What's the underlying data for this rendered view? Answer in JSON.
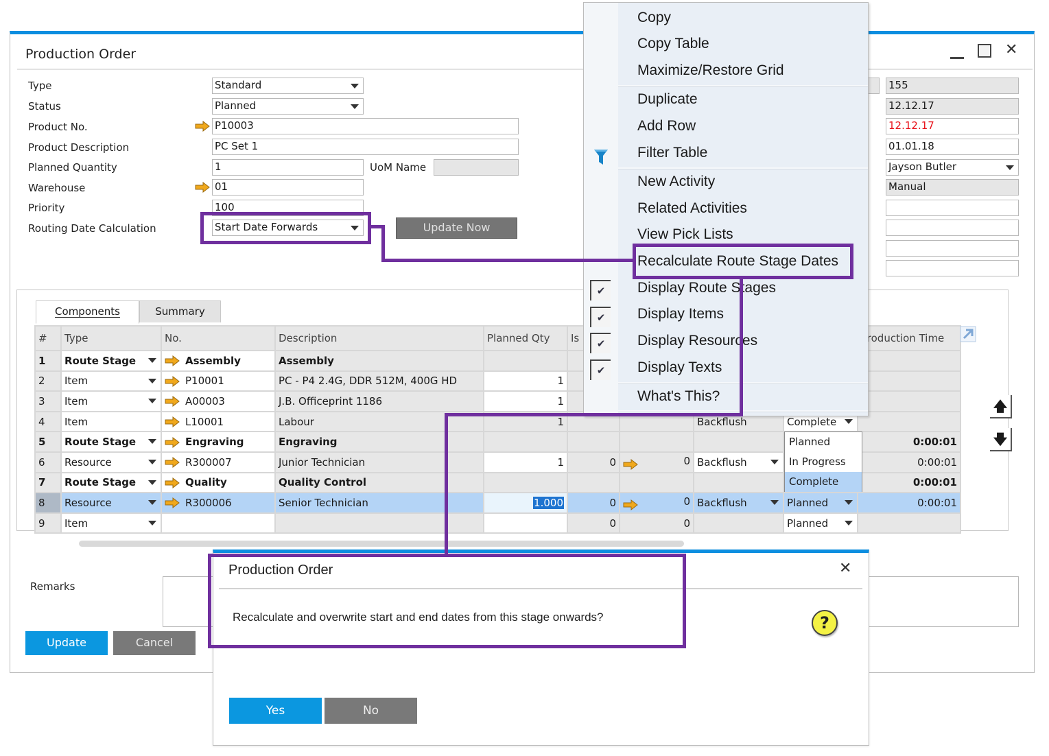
{
  "window": {
    "title": "Production Order",
    "controls": [
      "minimize-icon",
      "maximize-icon",
      "close-icon"
    ]
  },
  "header_left": {
    "type": {
      "label": "Type",
      "value": "Standard"
    },
    "status": {
      "label": "Status",
      "value": "Planned"
    },
    "product_no": {
      "label": "Product No.",
      "value": "P10003"
    },
    "product_description": {
      "label": "Product Description",
      "value": "PC Set 1"
    },
    "planned_quantity": {
      "label": "Planned Quantity",
      "value": "1"
    },
    "uom_name": {
      "label": "UoM Name",
      "value": ""
    },
    "warehouse": {
      "label": "Warehouse",
      "value": "01"
    },
    "priority": {
      "label": "Priority",
      "value": "100"
    },
    "routing_date_calculation": {
      "label": "Routing Date Calculation",
      "value": "Start Date Forwards"
    },
    "update_now_label": "Update Now"
  },
  "header_right": {
    "values": [
      "155",
      "12.12.17",
      "12.12.17",
      "01.01.18",
      "Jayson Butler",
      "Manual",
      "",
      "",
      "",
      ""
    ],
    "due_date_color": "#e8121a"
  },
  "tabs": [
    {
      "label": "Components",
      "active": true
    },
    {
      "label": "Summary",
      "active": false
    }
  ],
  "grid": {
    "columns": [
      "#",
      "Type",
      "No.",
      "Description",
      "Planned Qty",
      "Is",
      "",
      "",
      "",
      "",
      "Production Time"
    ],
    "rows": [
      {
        "num": "1",
        "type": "Route Stage",
        "no": "Assembly",
        "desc": "Assembly",
        "planned": "",
        "issued": "",
        "available": "",
        "method": "",
        "status": "",
        "time": "",
        "bold": true
      },
      {
        "num": "2",
        "type": "Item",
        "no": "P10001",
        "desc": "PC - P4 2.4G, DDR 512M, 400G HD",
        "planned": "1",
        "issued": "",
        "available": "",
        "method": "",
        "status": "",
        "time": ""
      },
      {
        "num": "3",
        "type": "Item",
        "no": "A00003",
        "desc": "J.B. Officeprint 1186",
        "planned": "1",
        "issued": "",
        "available": "",
        "method": "",
        "status": "",
        "time": ""
      },
      {
        "num": "4",
        "type": "Item",
        "no": "L10001",
        "desc": "Labour",
        "planned": "1",
        "issued": "",
        "available": "",
        "method": "Backflush",
        "status": "Complete",
        "time": ""
      },
      {
        "num": "5",
        "type": "Route Stage",
        "no": "Engraving",
        "desc": "Engraving",
        "planned": "",
        "issued": "",
        "available": "",
        "method": "",
        "status": "",
        "time": "0:00:01",
        "bold": true
      },
      {
        "num": "6",
        "type": "Resource",
        "no": "R300007",
        "desc": "Junior Technician",
        "planned": "1",
        "issued": "0",
        "available": "0",
        "method": "Backflush",
        "status": "",
        "time": "0:00:01"
      },
      {
        "num": "7",
        "type": "Route Stage",
        "no": "Quality",
        "desc": "Quality Control",
        "planned": "",
        "issued": "",
        "available": "",
        "method": "",
        "status": "",
        "time": "0:00:01",
        "bold": true
      },
      {
        "num": "8",
        "type": "Resource",
        "no": "R300006",
        "desc": "Senior Technician",
        "planned": "1.000",
        "issued": "0",
        "available": "0",
        "method": "Backflush",
        "status": "Planned",
        "time": "0:00:01",
        "selected": true
      },
      {
        "num": "9",
        "type": "Item",
        "no": "",
        "desc": "",
        "planned": "",
        "issued": "0",
        "available": "0",
        "method": "",
        "status": "Planned",
        "time": ""
      }
    ]
  },
  "status_dropdown": {
    "options": [
      "Planned",
      "In Progress",
      "Complete"
    ],
    "highlighted": "Complete"
  },
  "remarks": {
    "label": "Remarks",
    "value": ""
  },
  "footer": {
    "update_label": "Update",
    "cancel_label": "Cancel"
  },
  "context_menu": {
    "items": [
      {
        "label": "Copy",
        "group": 1
      },
      {
        "label": "Copy Table",
        "group": 1
      },
      {
        "label": "Maximize/Restore Grid",
        "group": 1
      },
      {
        "label": "Duplicate",
        "group": 2
      },
      {
        "label": "Add Row",
        "group": 2
      },
      {
        "label": "Filter Table",
        "group": 2,
        "icon": "filter-icon"
      },
      {
        "label": "New Activity",
        "group": 3
      },
      {
        "label": "Related Activities",
        "group": 3
      },
      {
        "label": "View Pick Lists",
        "group": 3
      },
      {
        "label": "Recalculate Route Stage Dates",
        "group": 3,
        "highlighted": true
      },
      {
        "label": "Display Route Stages",
        "group": 3,
        "checked": true
      },
      {
        "label": "Display Items",
        "group": 3,
        "checked": true
      },
      {
        "label": "Display Resources",
        "group": 3,
        "checked": true
      },
      {
        "label": "Display Texts",
        "group": 3,
        "checked": true
      },
      {
        "label": "What's This?",
        "group": 4
      }
    ]
  },
  "dialog": {
    "title": "Production Order",
    "message": "Recalculate and overwrite start and end dates from this stage onwards?",
    "icon": "question-icon",
    "yes_label": "Yes",
    "no_label": "No"
  },
  "colors": {
    "accent_blue": "#0b97e0",
    "annotation_purple": "#6f2f9e",
    "selected_row": "#b4d4f6",
    "link_arrow": "#f0a81c"
  }
}
